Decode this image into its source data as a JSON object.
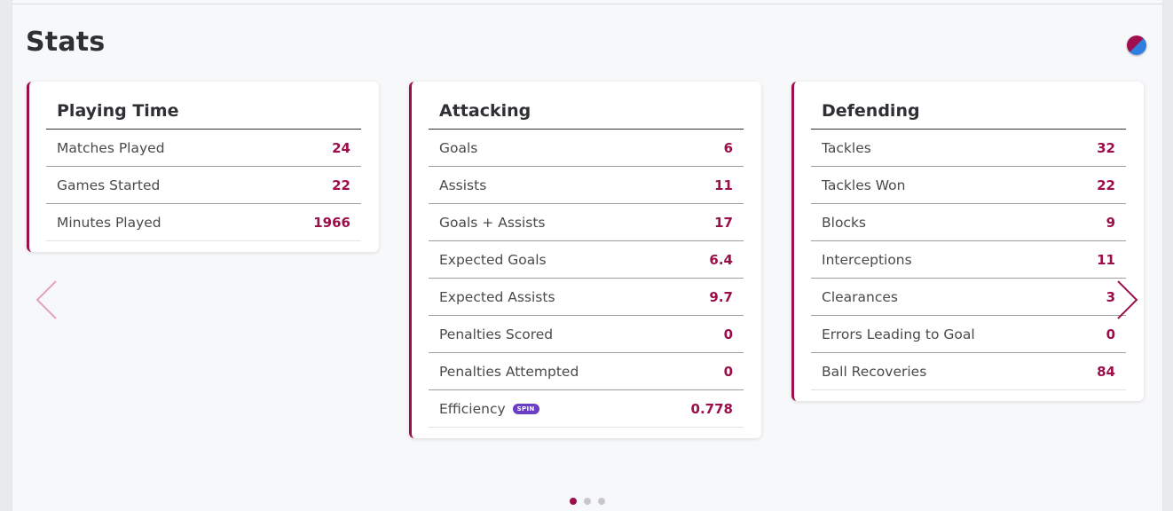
{
  "section_title": "Stats",
  "club_logo_icon": "club-crest-icon",
  "colors": {
    "accent": "#9b0f4a",
    "badge": "#6b3fc4"
  },
  "cards": [
    {
      "title": "Playing Time",
      "rows": [
        {
          "label": "Matches Played",
          "value": "24"
        },
        {
          "label": "Games Started",
          "value": "22"
        },
        {
          "label": "Minutes Played",
          "value": "1966"
        }
      ]
    },
    {
      "title": "Attacking",
      "rows": [
        {
          "label": "Goals",
          "value": "6"
        },
        {
          "label": "Assists",
          "value": "11"
        },
        {
          "label": "Goals + Assists",
          "value": "17"
        },
        {
          "label": "Expected Goals",
          "value": "6.4"
        },
        {
          "label": "Expected Assists",
          "value": "9.7"
        },
        {
          "label": "Penalties Scored",
          "value": "0"
        },
        {
          "label": "Penalties Attempted",
          "value": "0"
        },
        {
          "label": "Efficiency",
          "value": "0.778",
          "badge": "SPIN"
        }
      ]
    },
    {
      "title": "Defending",
      "rows": [
        {
          "label": "Tackles",
          "value": "32"
        },
        {
          "label": "Tackles Won",
          "value": "22"
        },
        {
          "label": "Blocks",
          "value": "9"
        },
        {
          "label": "Interceptions",
          "value": "11"
        },
        {
          "label": "Clearances",
          "value": "3"
        },
        {
          "label": "Errors Leading to Goal",
          "value": "0"
        },
        {
          "label": "Ball Recoveries",
          "value": "84"
        }
      ]
    }
  ],
  "carousel": {
    "prev_icon": "chevron-left-icon",
    "next_icon": "chevron-right-icon",
    "pages": 3,
    "active_page": 1
  }
}
